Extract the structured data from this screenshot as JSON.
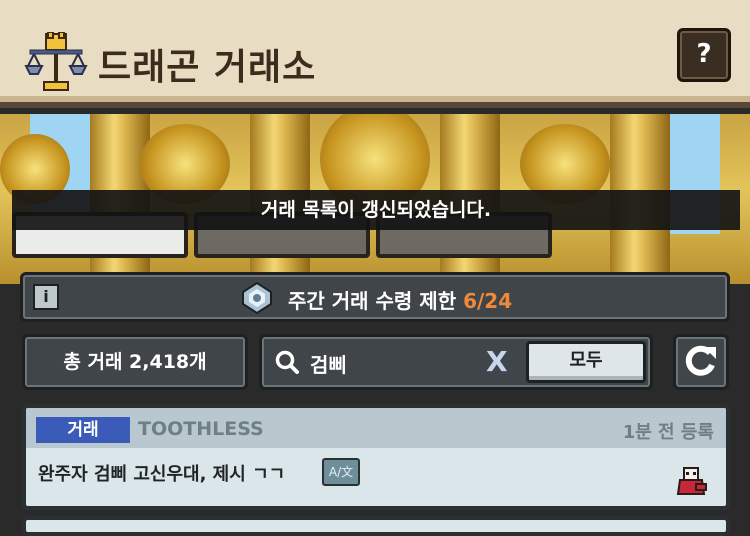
{
  "header": {
    "title": "드래곤 거래소",
    "help_label": "?"
  },
  "toast": {
    "message": "거래 목록이 갱신되었습니다."
  },
  "info": {
    "info_icon": "i",
    "limit_label": "주간 거래 수령 제한",
    "limit_value": "6/24"
  },
  "summary": {
    "total_trades": "총 거래 2,418개"
  },
  "search": {
    "query": "검삐",
    "clear_label": "X",
    "filter_label": "모두"
  },
  "listings": [
    {
      "tag": "거래",
      "seller": "TOOTHLESS",
      "time": "1분 전 등록",
      "message": "완주자 검삐 고신우대, 제시 ㄱㄱ",
      "translate_label": "A/文"
    }
  ],
  "icons": {
    "logo": "scales-cat-icon",
    "limit": "trade-limit-emblem-icon",
    "search": "search-icon",
    "refresh": "refresh-icon",
    "avatar": "dragon-avatar-icon"
  },
  "colors": {
    "accent_orange": "#f08a3a",
    "tag_blue": "#3a5bb7",
    "panel_dark": "#3f4548",
    "header_bg": "#e8dcc2"
  }
}
